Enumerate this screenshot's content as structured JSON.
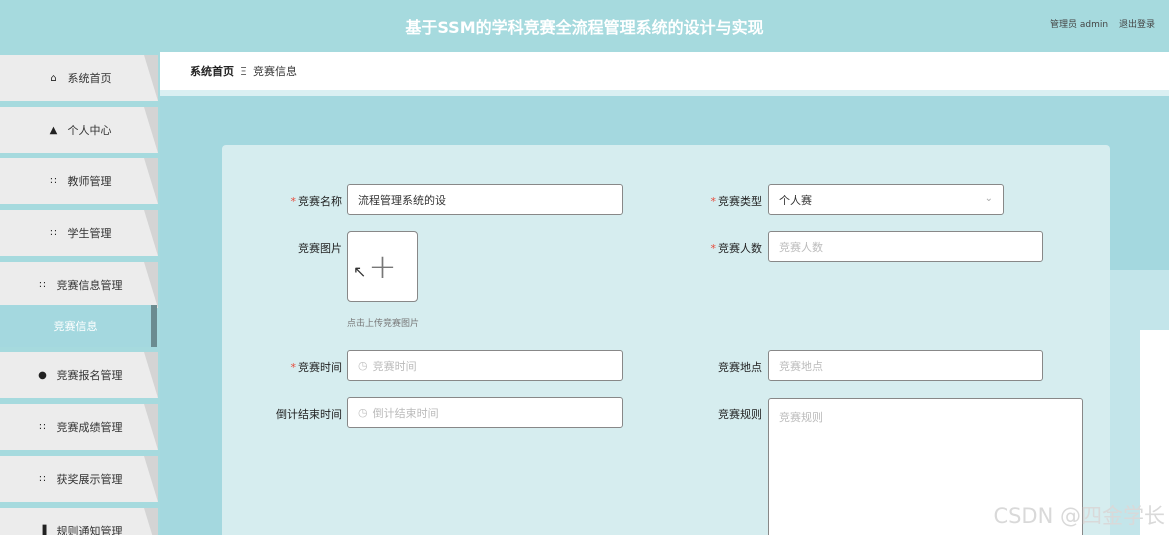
{
  "header": {
    "title": "基于SSM的学科竞赛全流程管理系统的设计与实现",
    "admin_label": "管理员 admin",
    "logout_label": "退出登录"
  },
  "sidebar": {
    "items": [
      {
        "label": "系统首页",
        "icon": "home-icon",
        "glyph": "⌂"
      },
      {
        "label": "个人中心",
        "icon": "user-icon",
        "glyph": "▲"
      },
      {
        "label": "教师管理",
        "icon": "grid-icon",
        "glyph": "∷"
      },
      {
        "label": "学生管理",
        "icon": "grid-icon",
        "glyph": "∷"
      },
      {
        "label": "竞赛信息管理",
        "icon": "grid-icon",
        "glyph": "∷"
      },
      {
        "label": "竞赛信息",
        "icon": "",
        "glyph": ""
      },
      {
        "label": "竞赛报名管理",
        "icon": "pin-icon",
        "glyph": "●"
      },
      {
        "label": "竞赛成绩管理",
        "icon": "grid-icon",
        "glyph": "∷"
      },
      {
        "label": "获奖展示管理",
        "icon": "grid-icon",
        "glyph": "∷"
      },
      {
        "label": "规则通知管理",
        "icon": "bar-chart-icon",
        "glyph": "▐"
      }
    ]
  },
  "breadcrumb": {
    "home": "系统首页",
    "separator": "Ξ",
    "current": "竞赛信息"
  },
  "form": {
    "name_label": "竞赛名称",
    "name_value": "流程管理系统的设",
    "type_label": "竞赛类型",
    "type_value": "个人赛",
    "image_label": "竞赛图片",
    "upload_plus": "+",
    "upload_hint": "点击上传竞赛图片",
    "count_label": "竞赛人数",
    "count_placeholder": "竞赛人数",
    "time_label": "竞赛时间",
    "time_placeholder": "竞赛时间",
    "place_label": "竞赛地点",
    "place_placeholder": "竞赛地点",
    "countdown_label": "倒计结束时间",
    "countdown_placeholder": "倒计结束时间",
    "rules_label": "竞赛规则",
    "rules_placeholder": "竞赛规则",
    "required_mark": "*"
  },
  "watermark": "CSDN @四金学长",
  "colors": {
    "theme": "#a6dade",
    "active_menu_border": "#6b8c90",
    "required": "#e74c3c"
  }
}
